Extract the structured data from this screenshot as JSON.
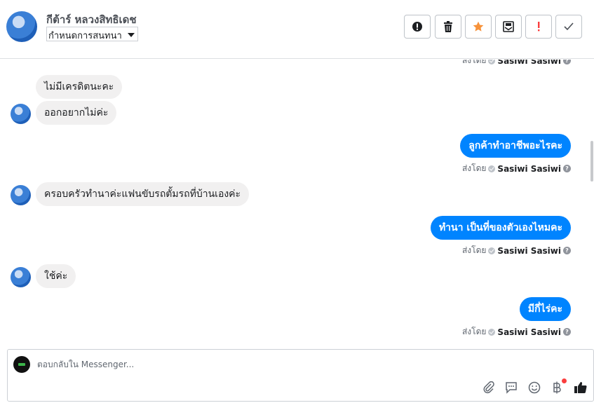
{
  "header": {
    "contact_name": "กีต้าร์ หลวงสิทธิเดช",
    "label_select": "กำหนดการสนทนา"
  },
  "toolbar": [
    {
      "icon": "alert-circle-icon"
    },
    {
      "icon": "trash-icon"
    },
    {
      "icon": "star-icon",
      "color": "#f7923a"
    },
    {
      "icon": "archive-icon"
    },
    {
      "icon": "spam-icon",
      "color": "#fa3e3e"
    },
    {
      "icon": "check-icon"
    }
  ],
  "messages": {
    "top_sent_by": {
      "prefix": "ส่งโดย",
      "sender": "Sasiwi Sasiwi"
    },
    "in1": "ไม่มีเครดิตนะคะ",
    "in2": "ออกอยากไม่ค่ะ",
    "out1": "ลูกค้าทำอาชีพอะไรคะ",
    "out1_sent_by": {
      "prefix": "ส่งโดย",
      "sender": "Sasiwi Sasiwi"
    },
    "in3": "ครอบครัวทำนาค่ะแฟนขับรถตั้มรถที่บ้านเองค่ะ",
    "out2": "ทำนา เป็นที่ของตัวเองไหมคะ",
    "out2_sent_by": {
      "prefix": "ส่งโดย",
      "sender": "Sasiwi Sasiwi"
    },
    "in4": "ใช้ค่ะ",
    "out3": "มีกี่ไร่คะ",
    "out3_sent_by": {
      "prefix": "ส่งโดย",
      "sender": "Sasiwi Sasiwi"
    }
  },
  "composer": {
    "placeholder": "ตอบกลับใน Messenger...",
    "icons": [
      "attach-icon",
      "saved-reply-icon",
      "emoji-icon",
      "baht-payment-icon",
      "thumbs-up-icon"
    ],
    "accent": "#0084ff"
  }
}
